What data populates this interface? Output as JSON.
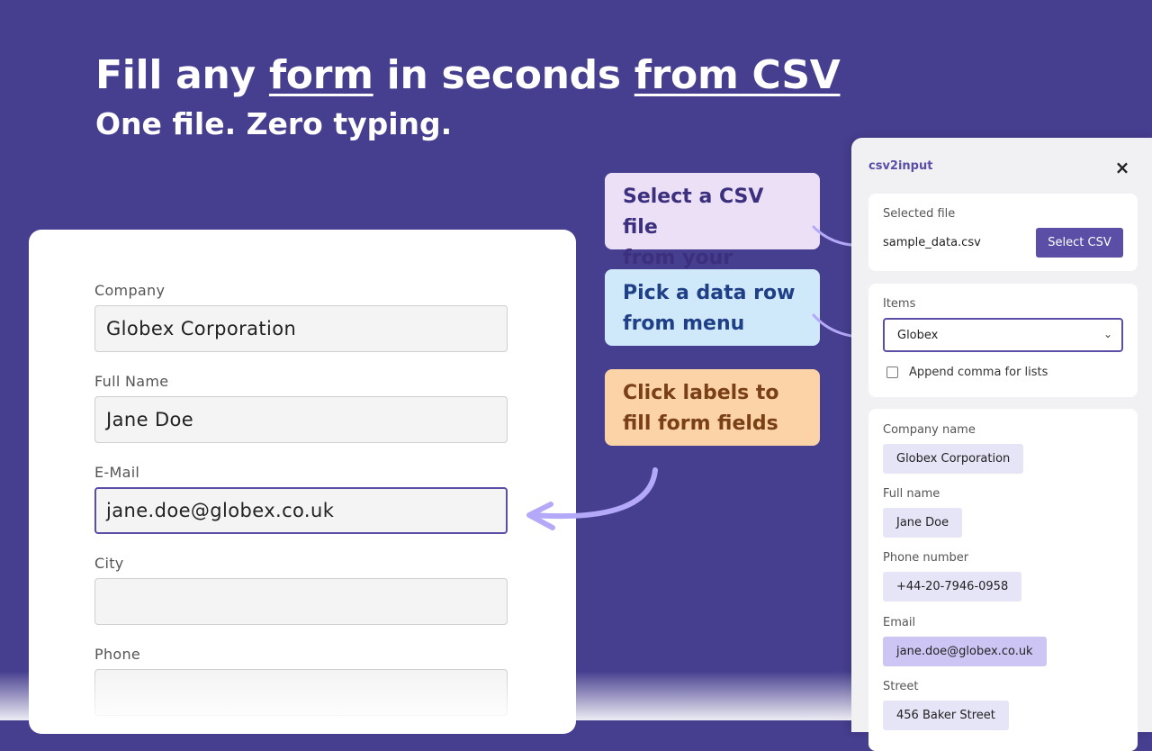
{
  "headline": {
    "part1": "Fill any ",
    "form_word": "form",
    "part2": " in seconds ",
    "from_csv": "from CSV",
    "subline": "One file. Zero typing."
  },
  "form": {
    "fields": [
      {
        "label": "Company",
        "value": "Globex Corporation"
      },
      {
        "label": "Full Name",
        "value": "Jane Doe"
      },
      {
        "label": "E-Mail",
        "value": "jane.doe@globex.co.uk"
      },
      {
        "label": "City",
        "value": ""
      },
      {
        "label": "Phone",
        "value": ""
      }
    ]
  },
  "callouts": {
    "select_line1": "Select a CSV file",
    "select_line2": "from your device",
    "pick_line1": "Pick a data row",
    "pick_line2": "from menu",
    "click_line1": "Click labels to",
    "click_line2": "fill form fields"
  },
  "panel": {
    "title": "csv2input",
    "close_icon": "×",
    "selected_file_label": "Selected file",
    "file_name": "sample_data.csv",
    "select_button": "Select CSV",
    "items_label": "Items",
    "selected_item": "Globex",
    "chevron_icon": "⌄",
    "append_comma_label": "Append comma for lists",
    "append_comma_checked": false,
    "data": [
      {
        "label": "Company name",
        "value": "Globex Corporation"
      },
      {
        "label": "Full name",
        "value": "Jane Doe"
      },
      {
        "label": "Phone number",
        "value": "+44-20-7946-0958"
      },
      {
        "label": "Email",
        "value": "jane.doe@globex.co.uk"
      },
      {
        "label": "Street",
        "value": "456 Baker Street"
      }
    ]
  },
  "colors": {
    "background": "#463e8f",
    "accent": "#5a4ea7",
    "arrow": "#b4a8f8"
  }
}
